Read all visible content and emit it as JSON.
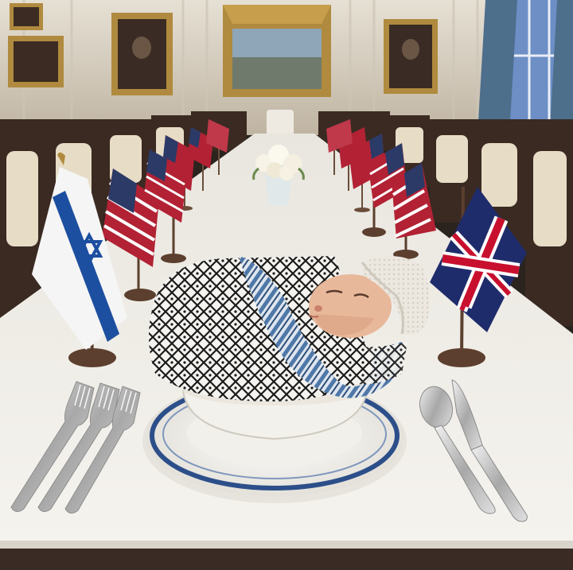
{
  "scene": {
    "kind": "photo-illustration",
    "elements": {
      "room": "banquet-hall",
      "table": "long-dining-table",
      "flags": [
        "israel-flag",
        "us-flag",
        "uk-flag"
      ],
      "centerpiece": "white-flower-bouquet",
      "subject": "sleeping-infant-in-keffiyeh",
      "place_setting": [
        "forks",
        "spoon",
        "knife",
        "plate",
        "bowl"
      ]
    }
  },
  "colors": {
    "wall": "#d9d2c3",
    "tablecloth": "#f1efea",
    "chair_wood": "#3a2a22",
    "chair_pad": "#e7dcc6",
    "frame_gold": "#b08a3e",
    "israel_blue": "#1d4fa0",
    "us_red": "#b22234",
    "us_blue": "#2b3a67",
    "uk_blue": "#1f2c6b",
    "uk_red": "#c8102e",
    "plate_rim": "#2c4f8a",
    "skin": "#e8b89a",
    "hat": "#ece7df",
    "keffiyeh_scarf": "#4f78a8"
  }
}
